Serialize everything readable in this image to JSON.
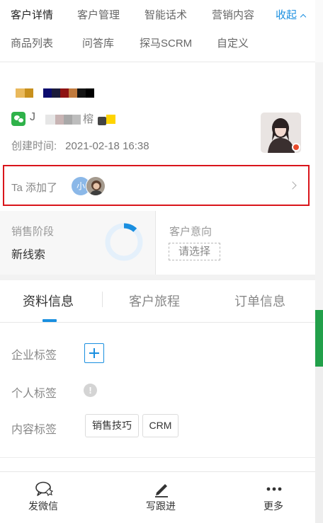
{
  "nav": {
    "row1": [
      "客户详情",
      "客户管理",
      "智能话术",
      "营销内容"
    ],
    "collapse_label": "收起",
    "row2": [
      "商品列表",
      "问答库",
      "探马SCRM",
      "自定义"
    ]
  },
  "profile": {
    "nickname_initial": "J",
    "nickname_tail": "榕",
    "created_label": "创建时间:",
    "created_value": "2021-02-18 16:38"
  },
  "added": {
    "label": "Ta 添加了",
    "avatar_text": "小"
  },
  "stage": {
    "title": "销售阶段",
    "value": "新线索",
    "progress": 0.12
  },
  "intent": {
    "title": "客户意向",
    "placeholder": "请选择"
  },
  "tabs": [
    "资料信息",
    "客户旅程",
    "订单信息"
  ],
  "active_tab": 0,
  "tags": {
    "company_label": "企业标签",
    "personal_label": "个人标签",
    "content_label": "内容标签",
    "content_chips": [
      "销售技巧",
      "CRM"
    ]
  },
  "bottom": {
    "items": [
      {
        "label": "发微信",
        "icon": "chat-icon"
      },
      {
        "label": "写跟进",
        "icon": "pen-icon"
      },
      {
        "label": "更多",
        "icon": "more-icon"
      }
    ]
  },
  "colors": {
    "accent": "#1a8fe0",
    "highlight_border": "#d9151b",
    "wechat_green": "#2fb24a"
  }
}
